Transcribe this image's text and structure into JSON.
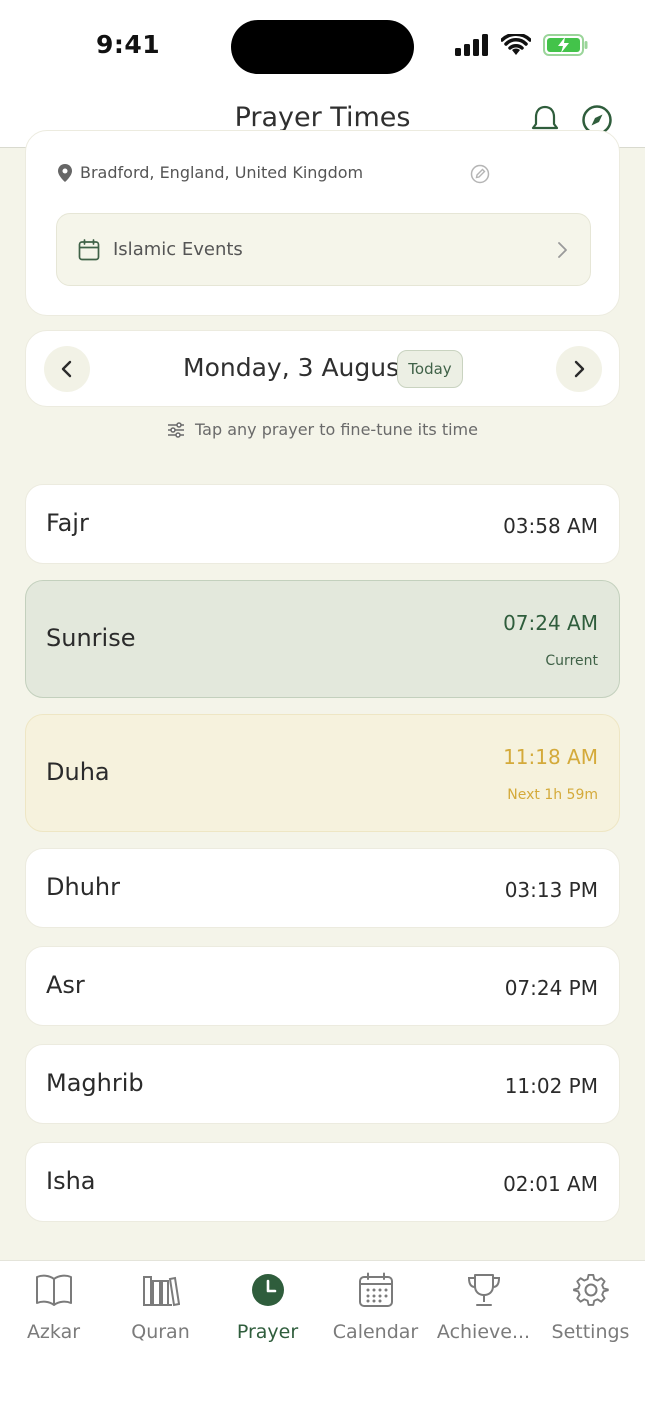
{
  "status_bar": {
    "time": "9:41"
  },
  "header": {
    "title": "Prayer Times"
  },
  "location": {
    "text": "Bradford, England, United Kingdom",
    "events_label": "Islamic Events"
  },
  "date_nav": {
    "date": "Monday, 3 August",
    "today_label": "Today"
  },
  "hint": "Tap any prayer to fine-tune its time",
  "prayers": [
    {
      "name": "Fajr",
      "time": "03:58 AM",
      "sub": ""
    },
    {
      "name": "Sunrise",
      "time": "07:24 AM",
      "sub": "Current"
    },
    {
      "name": "Duha",
      "time": "11:18 AM",
      "sub": "Next 1h 59m"
    },
    {
      "name": "Dhuhr",
      "time": "03:13 PM",
      "sub": ""
    },
    {
      "name": "Asr",
      "time": "07:24 PM",
      "sub": ""
    },
    {
      "name": "Maghrib",
      "time": "11:02 PM",
      "sub": ""
    },
    {
      "name": "Isha",
      "time": "02:01 AM",
      "sub": ""
    }
  ],
  "tabs": [
    {
      "label": "Azkar",
      "icon": "book-open-icon"
    },
    {
      "label": "Quran",
      "icon": "books-icon"
    },
    {
      "label": "Prayer",
      "icon": "clock-icon"
    },
    {
      "label": "Calendar",
      "icon": "calendar-icon"
    },
    {
      "label": "Achieve...",
      "icon": "trophy-icon"
    },
    {
      "label": "Settings",
      "icon": "gear-icon"
    }
  ],
  "active_tab": "Prayer",
  "colors": {
    "accent": "#2f5d3c",
    "current_bg": "#e3e8dc",
    "next_bg": "#f6f2dd",
    "next_text": "#d4aa3a",
    "background": "#f4f4e9"
  }
}
